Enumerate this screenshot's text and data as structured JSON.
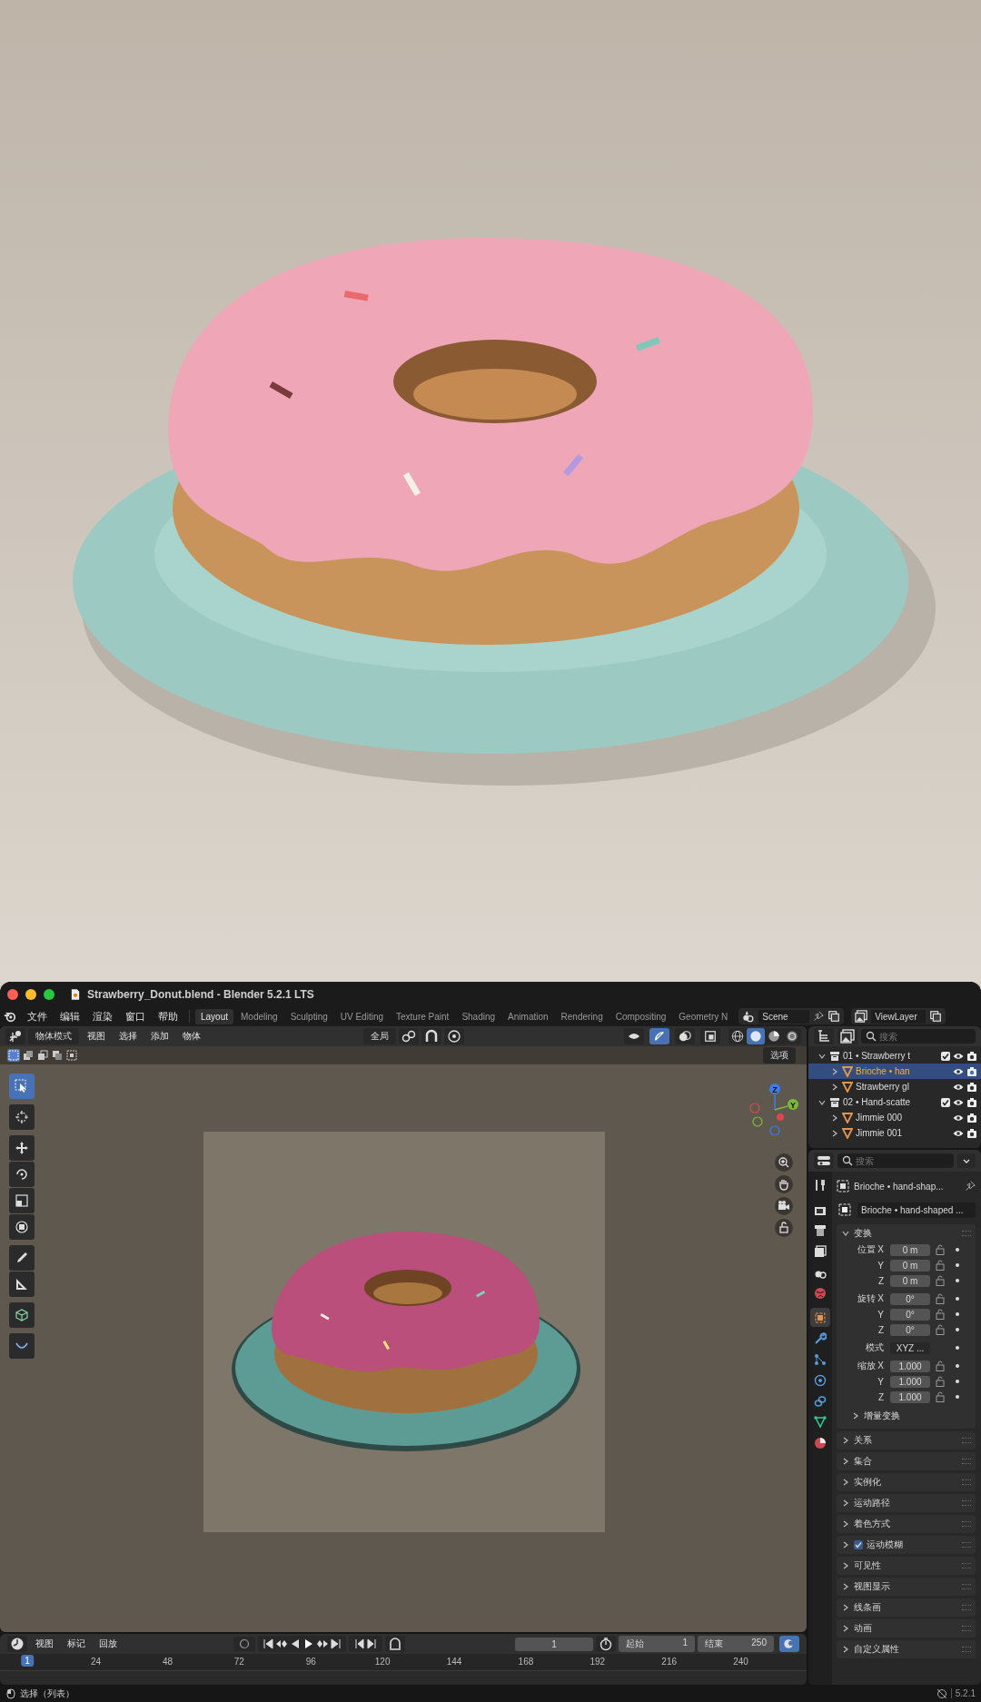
{
  "window": {
    "title": "Strawberry_Donut.blend - Blender 5.2.1 LTS"
  },
  "menu": [
    "文件",
    "编辑",
    "渲染",
    "窗口",
    "帮助"
  ],
  "workspaces": [
    {
      "label": "Layout",
      "selected": true
    },
    {
      "label": "Modeling",
      "selected": false
    },
    {
      "label": "Sculpting",
      "selected": false
    },
    {
      "label": "UV Editing",
      "selected": false
    },
    {
      "label": "Texture Paint",
      "selected": false
    },
    {
      "label": "Shading",
      "selected": false
    },
    {
      "label": "Animation",
      "selected": false
    },
    {
      "label": "Rendering",
      "selected": false
    },
    {
      "label": "Compositing",
      "selected": false
    },
    {
      "label": "Geometry N",
      "selected": false
    }
  ],
  "scene": {
    "name": "Scene"
  },
  "view_layer": {
    "name": "ViewLayer"
  },
  "viewport": {
    "mode": "物体模式",
    "menus": [
      "视图",
      "选择",
      "添加",
      "物体"
    ],
    "orientation": "全局",
    "options": "选项",
    "toggles": [
      {
        "kind": "visibility",
        "on": false
      },
      {
        "kind": "gizmo",
        "on": true
      },
      {
        "kind": "overlay",
        "on": false
      },
      {
        "kind": "xray",
        "on": false
      }
    ],
    "shading": [
      {
        "kind": "wireframe",
        "selected": false
      },
      {
        "kind": "solid",
        "selected": true
      },
      {
        "kind": "material",
        "selected": false
      },
      {
        "kind": "rendered",
        "selected": false
      }
    ],
    "select_modes": [
      {
        "kind": "set",
        "selected": true
      },
      {
        "kind": "extend",
        "selected": false
      },
      {
        "kind": "subtract",
        "selected": false
      },
      {
        "kind": "invert",
        "selected": false
      },
      {
        "kind": "intersect",
        "selected": false
      }
    ],
    "tool_groups": [
      [
        {
          "kind": "select",
          "selected": true
        }
      ],
      [
        {
          "kind": "cursor",
          "selected": false
        }
      ],
      [
        {
          "kind": "move",
          "selected": false
        },
        {
          "kind": "rotate",
          "selected": false
        },
        {
          "kind": "scale",
          "selected": false
        },
        {
          "kind": "transform",
          "selected": false
        }
      ],
      [
        {
          "kind": "annotate",
          "selected": false
        },
        {
          "kind": "measure",
          "selected": false
        }
      ],
      [
        {
          "kind": "add_cube",
          "selected": false
        }
      ],
      [
        {
          "kind": "curve",
          "selected": false
        }
      ]
    ],
    "gizmo_axes": [
      "Z",
      "Y"
    ]
  },
  "outliner": {
    "search_placeholder": "搜索",
    "items": [
      {
        "name": "01 • Strawberry t",
        "kind": "collection",
        "expanded": true,
        "checked": true,
        "selected": false,
        "children": [
          {
            "name": "Brioche • han",
            "kind": "mesh",
            "expanded": false,
            "selected": true
          },
          {
            "name": "Strawberry gl",
            "kind": "mesh",
            "expanded": false,
            "selected": false
          }
        ]
      },
      {
        "name": "02 • Hand-scatte",
        "kind": "collection",
        "expanded": true,
        "checked": true,
        "selected": false,
        "children": [
          {
            "name": "Jimmie 000",
            "kind": "mesh",
            "expanded": false,
            "selected": false
          },
          {
            "name": "Jimmie 001",
            "kind": "mesh",
            "expanded": false,
            "selected": false
          }
        ]
      }
    ]
  },
  "properties": {
    "search_placeholder": "搜索",
    "tabs": [
      {
        "kind": "tool",
        "selected": false
      },
      {
        "kind": "render",
        "selected": false
      },
      {
        "kind": "output",
        "selected": false
      },
      {
        "kind": "view_layer",
        "selected": false
      },
      {
        "kind": "scene",
        "selected": false
      },
      {
        "kind": "world",
        "selected": false
      },
      {
        "kind": "object",
        "selected": true
      },
      {
        "kind": "modifiers",
        "selected": false
      },
      {
        "kind": "particles",
        "selected": false
      },
      {
        "kind": "physics",
        "selected": false
      },
      {
        "kind": "constraints",
        "selected": false
      },
      {
        "kind": "data",
        "selected": false
      },
      {
        "kind": "material",
        "selected": false
      }
    ],
    "object_name": "Brioche • hand-shap...",
    "data_name": "Brioche • hand-shaped ...",
    "transform": {
      "title": "变换",
      "expanded": true,
      "rows": [
        {
          "kind": "field",
          "label": "位置 X",
          "value": "0 m"
        },
        {
          "kind": "field",
          "label": "Y",
          "value": "0 m"
        },
        {
          "kind": "field",
          "label": "Z",
          "value": "0 m"
        },
        {
          "kind": "field",
          "label": "旋转 X",
          "value": "0°"
        },
        {
          "kind": "field",
          "label": "Y",
          "value": "0°"
        },
        {
          "kind": "field",
          "label": "Z",
          "value": "0°"
        },
        {
          "kind": "dropdown",
          "label": "模式",
          "value": "XYZ ..."
        },
        {
          "kind": "field",
          "label": "缩放 X",
          "value": "1.000"
        },
        {
          "kind": "field",
          "label": "Y",
          "value": "1.000"
        },
        {
          "kind": "field",
          "label": "Z",
          "value": "1.000"
        }
      ],
      "subpanel": {
        "title": "增量变换",
        "expanded": false
      }
    },
    "panels": [
      {
        "label": "关系",
        "expanded": false
      },
      {
        "label": "集合",
        "expanded": false
      },
      {
        "label": "实例化",
        "expanded": false
      },
      {
        "label": "运动路径",
        "expanded": false
      },
      {
        "label": "着色方式",
        "expanded": false
      },
      {
        "label": "运动模糊",
        "expanded": false,
        "checked": true
      },
      {
        "label": "可见性",
        "expanded": false
      },
      {
        "label": "视图显示",
        "expanded": false
      },
      {
        "label": "线条画",
        "expanded": false
      },
      {
        "label": "动画",
        "expanded": false
      },
      {
        "label": "自定义属性",
        "expanded": false
      }
    ]
  },
  "timeline": {
    "menus": [
      "视图",
      "标记",
      "回放"
    ],
    "auto_key": false,
    "current_frame": "1",
    "start_label": "起始",
    "start": "1",
    "end_label": "结束",
    "end": "250",
    "camera_sync": true,
    "playhead": "1",
    "ticks": [
      "24",
      "48",
      "72",
      "96",
      "120",
      "144",
      "168",
      "192",
      "216",
      "240"
    ]
  },
  "status_bar": {
    "hint": "选择（列表）",
    "version": "5.2.1"
  }
}
